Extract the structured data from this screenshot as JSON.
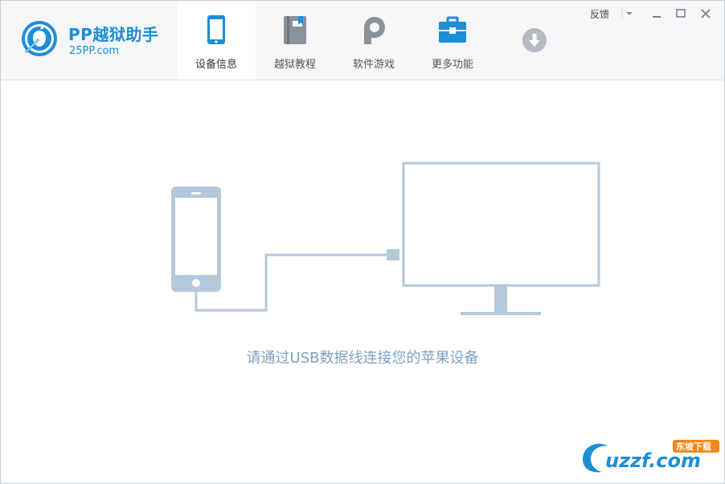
{
  "app": {
    "name": "PP越狱助手",
    "domain": "25PP.com"
  },
  "tabs": [
    {
      "label": "设备信息",
      "icon": "phone-icon",
      "active": true
    },
    {
      "label": "越狱教程",
      "icon": "book-icon",
      "active": false
    },
    {
      "label": "软件游戏",
      "icon": "pp-logo-icon",
      "active": false
    },
    {
      "label": "更多功能",
      "icon": "toolbox-icon",
      "active": false
    }
  ],
  "download_icon": "download-icon",
  "controls": {
    "feedback": "反馈"
  },
  "main": {
    "message": "请通过USB数据线连接您的苹果设备"
  },
  "watermark": {
    "text": "uzzf.com",
    "badge": "东坡下载"
  },
  "colors": {
    "accent": "#1c8ed6",
    "illustration": "#b3c8da",
    "message": "#7ea2c1"
  }
}
